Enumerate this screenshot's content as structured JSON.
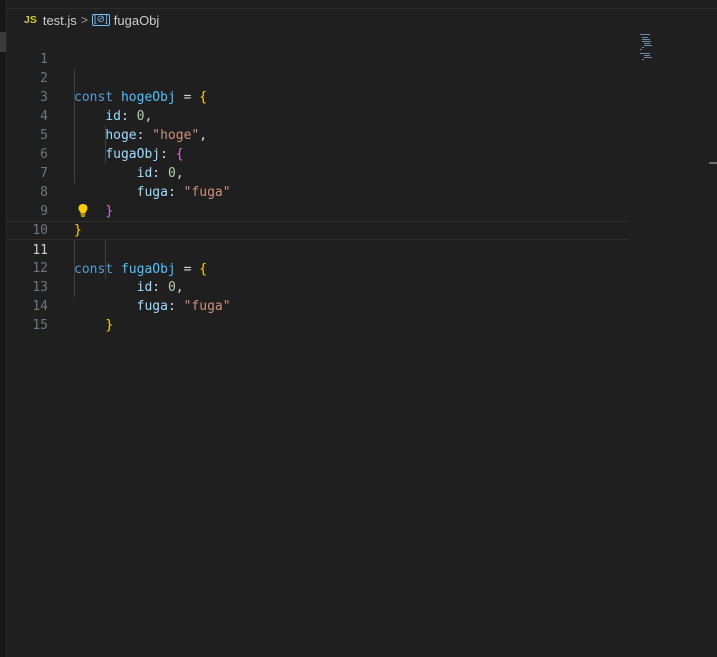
{
  "breadcrumb": {
    "file_badge": "JS",
    "file_name": "test.js",
    "separator": ">",
    "symbol_icon": "[⊘]",
    "symbol_name": "fugaObj"
  },
  "editor": {
    "active_line": 11,
    "lines": [
      {
        "n": "1"
      },
      {
        "n": "2"
      },
      {
        "n": "3"
      },
      {
        "n": "4"
      },
      {
        "n": "5"
      },
      {
        "n": "6"
      },
      {
        "n": "7"
      },
      {
        "n": "8"
      },
      {
        "n": "9"
      },
      {
        "n": "10"
      },
      {
        "n": "11"
      },
      {
        "n": "12"
      },
      {
        "n": "13"
      },
      {
        "n": "14"
      },
      {
        "n": "15"
      }
    ],
    "tokens": {
      "const": "const",
      "hogeObj": "hogeObj",
      "fugaObj": "fugaObj",
      "eq": " = ",
      "open": "{",
      "close": "}",
      "id": "id",
      "hoge": "hoge",
      "fuga": "fuga",
      "colon": ": ",
      "zero": "0",
      "comma": ",",
      "str_hoge": "\"hoge\"",
      "str_fuga": "\"fuga\""
    },
    "lightbulb_icon": "lightbulb-icon"
  },
  "colors": {
    "background": "#1f1f1f",
    "keyword": "#569cd6",
    "variable": "#4fc1ff",
    "property": "#9cdcfe",
    "number": "#b5cea8",
    "string": "#ce9178",
    "bracket_level1": "#ffd700",
    "bracket_level2": "#da70d6"
  }
}
